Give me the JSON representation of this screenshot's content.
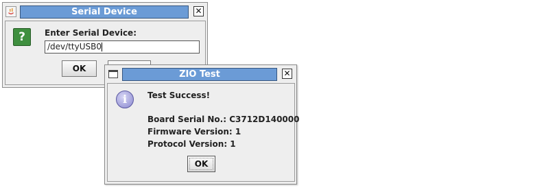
{
  "serial_dialog": {
    "title": "Serial Device",
    "prompt": "Enter Serial Device:",
    "input_value": "/dev/ttyUSB0",
    "ok_label": "OK",
    "close_glyph": "✕",
    "icon": "question-icon",
    "icon_glyph": "?"
  },
  "zio_dialog": {
    "title": "ZIO Test",
    "status": "Test Success!",
    "board_serial": "Board Serial No.: C3712D140000",
    "firmware": "Firmware Version: 1",
    "protocol": "Protocol Version: 1",
    "ok_label": "OK",
    "close_glyph": "✕",
    "icon": "info-icon",
    "icon_glyph": "i"
  },
  "colors": {
    "titlebar": "#6b9bd6",
    "dialog_bg": "#eeeeee",
    "question_icon": "#3f8f3f",
    "info_icon": "#8a88cf"
  }
}
